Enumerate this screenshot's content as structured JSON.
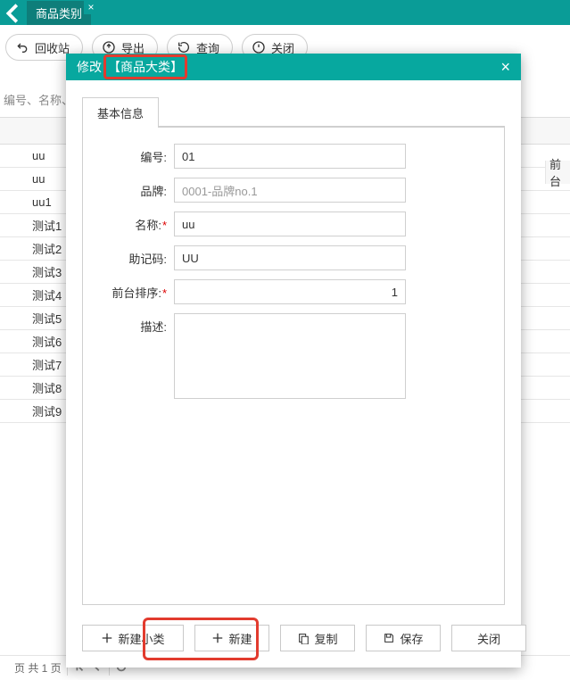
{
  "top_tab": {
    "label": "商品类别"
  },
  "toolbar": {
    "recycle": "回收站",
    "export": "导出",
    "query": "查询",
    "close": "关闭"
  },
  "search_placeholder_fragment": "编号、名称、助",
  "right_header_fragment": "前台",
  "list_rows": [
    "uu",
    "uu",
    "uu1",
    "测试1",
    "测试2",
    "测试3",
    "测试4",
    "测试5",
    "测试6",
    "测试7",
    "测试8",
    "测试9"
  ],
  "pager_text": "页 共 1 页",
  "modal": {
    "title_prefix": "修改",
    "title_highlight": "【商品大类】",
    "tab_basic": "基本信息",
    "labels": {
      "code": "编号:",
      "brand": "品牌:",
      "name": "名称:",
      "mnemonic": "助记码:",
      "front_sort": "前台排序:",
      "desc": "描述:"
    },
    "values": {
      "code": "01",
      "brand": "0001-品牌no.1",
      "name": "uu",
      "mnemonic": "UU",
      "front_sort": "1",
      "desc": ""
    },
    "buttons": {
      "new_sub": "新建小类",
      "new": "新建",
      "copy": "复制",
      "save": "保存",
      "close": "关闭"
    }
  }
}
